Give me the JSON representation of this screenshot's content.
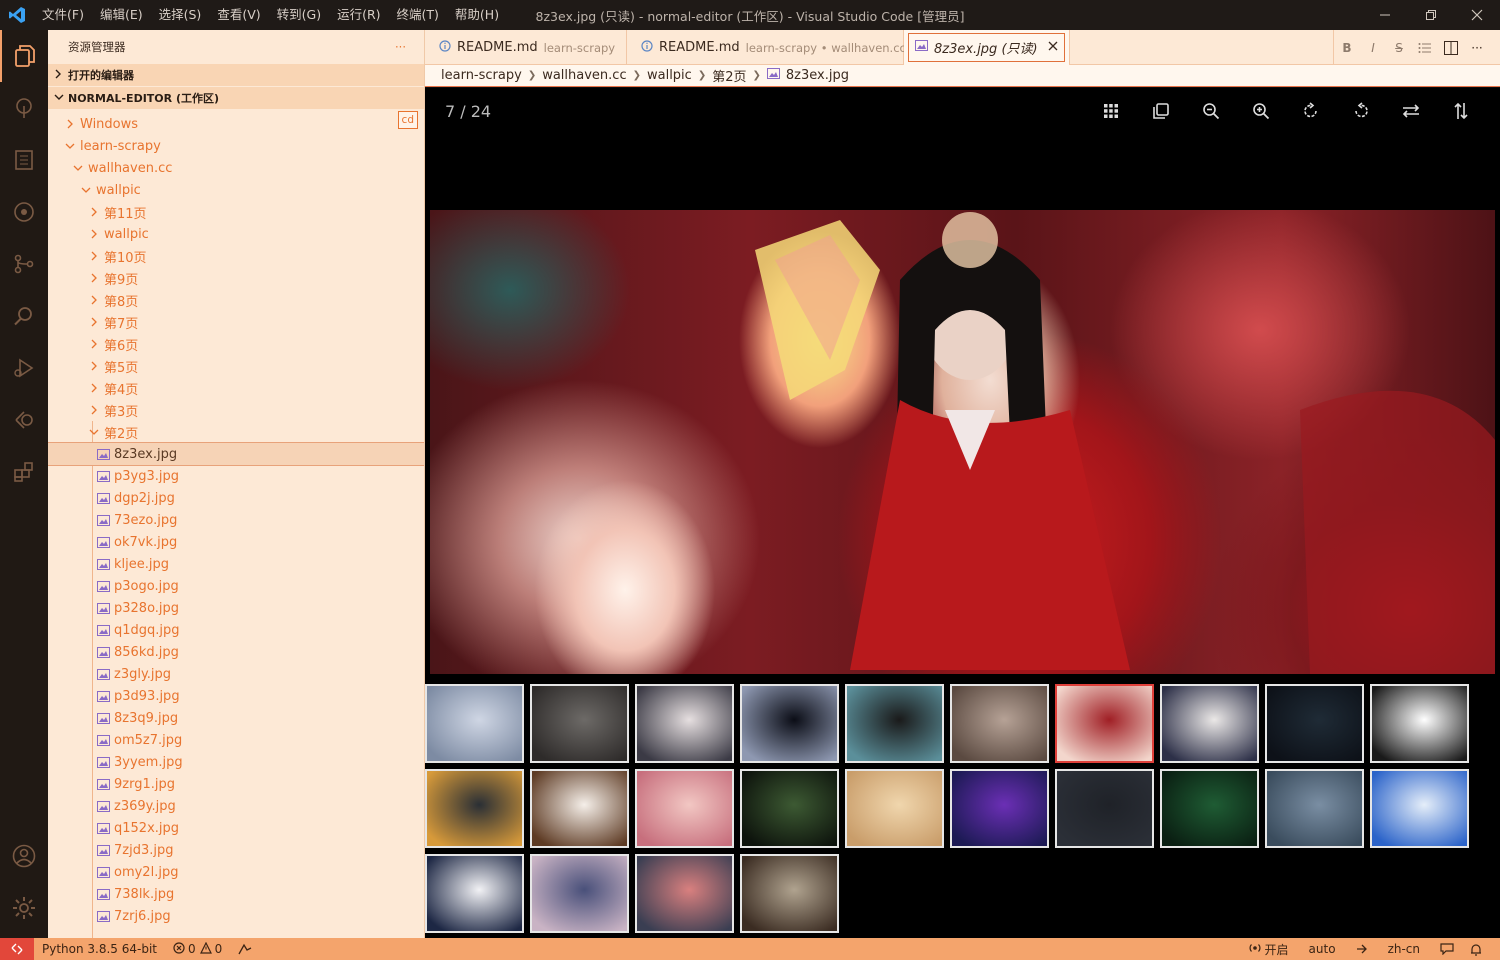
{
  "titlebar": {
    "menu": [
      "文件(F)",
      "编辑(E)",
      "选择(S)",
      "查看(V)",
      "转到(G)",
      "运行(R)",
      "终端(T)",
      "帮助(H)"
    ],
    "title": "8z3ex.jpg (只读) - normal-editor (工作区) - Visual Studio Code [管理员]"
  },
  "sidebar": {
    "header": "资源管理器",
    "more": "···",
    "open_editors": "打开的编辑器",
    "workspace": "NORMAL-EDITOR (工作区)",
    "cd_badge": "cd",
    "tree": [
      {
        "label": "Windows",
        "indent": 0,
        "type": "folder",
        "open": false
      },
      {
        "label": "learn-scrapy",
        "indent": 0,
        "type": "folder",
        "open": true
      },
      {
        "label": "wallhaven.cc",
        "indent": 1,
        "type": "folder",
        "open": true
      },
      {
        "label": "wallpic",
        "indent": 2,
        "type": "folder",
        "open": true
      },
      {
        "label": "第11页",
        "indent": 3,
        "type": "folder",
        "open": false
      },
      {
        "label": "wallpic",
        "indent": 3,
        "type": "folder",
        "open": false
      },
      {
        "label": "第10页",
        "indent": 3,
        "type": "folder",
        "open": false
      },
      {
        "label": "第9页",
        "indent": 3,
        "type": "folder",
        "open": false
      },
      {
        "label": "第8页",
        "indent": 3,
        "type": "folder",
        "open": false
      },
      {
        "label": "第7页",
        "indent": 3,
        "type": "folder",
        "open": false
      },
      {
        "label": "第6页",
        "indent": 3,
        "type": "folder",
        "open": false
      },
      {
        "label": "第5页",
        "indent": 3,
        "type": "folder",
        "open": false
      },
      {
        "label": "第4页",
        "indent": 3,
        "type": "folder",
        "open": false
      },
      {
        "label": "第3页",
        "indent": 3,
        "type": "folder",
        "open": false
      },
      {
        "label": "第2页",
        "indent": 3,
        "type": "folder",
        "open": true
      },
      {
        "label": "8z3ex.jpg",
        "indent": 4,
        "type": "file",
        "selected": true
      },
      {
        "label": "p3yg3.jpg",
        "indent": 4,
        "type": "file"
      },
      {
        "label": "dgp2j.jpg",
        "indent": 4,
        "type": "file"
      },
      {
        "label": "73ezo.jpg",
        "indent": 4,
        "type": "file"
      },
      {
        "label": "ok7vk.jpg",
        "indent": 4,
        "type": "file"
      },
      {
        "label": "kljee.jpg",
        "indent": 4,
        "type": "file"
      },
      {
        "label": "p3ogo.jpg",
        "indent": 4,
        "type": "file"
      },
      {
        "label": "p328o.jpg",
        "indent": 4,
        "type": "file"
      },
      {
        "label": "q1dgq.jpg",
        "indent": 4,
        "type": "file"
      },
      {
        "label": "856kd.jpg",
        "indent": 4,
        "type": "file"
      },
      {
        "label": "z3gly.jpg",
        "indent": 4,
        "type": "file"
      },
      {
        "label": "p3d93.jpg",
        "indent": 4,
        "type": "file"
      },
      {
        "label": "8z3q9.jpg",
        "indent": 4,
        "type": "file"
      },
      {
        "label": "om5z7.jpg",
        "indent": 4,
        "type": "file"
      },
      {
        "label": "3yyem.jpg",
        "indent": 4,
        "type": "file"
      },
      {
        "label": "9zrg1.jpg",
        "indent": 4,
        "type": "file"
      },
      {
        "label": "z369y.jpg",
        "indent": 4,
        "type": "file"
      },
      {
        "label": "q152x.jpg",
        "indent": 4,
        "type": "file"
      },
      {
        "label": "7zjd3.jpg",
        "indent": 4,
        "type": "file"
      },
      {
        "label": "omy2l.jpg",
        "indent": 4,
        "type": "file"
      },
      {
        "label": "738lk.jpg",
        "indent": 4,
        "type": "file"
      },
      {
        "label": "7zrj6.jpg",
        "indent": 4,
        "type": "file"
      }
    ]
  },
  "tabs": [
    {
      "label": "README.md",
      "desc": "learn-scrapy",
      "icon": "info-icon"
    },
    {
      "label": "README.md",
      "desc": "learn-scrapy • wallhaven.cc",
      "icon": "info-icon"
    },
    {
      "label": "8z3ex.jpg (只读)",
      "desc": "",
      "icon": "image-file-icon",
      "active": true
    }
  ],
  "tab_actions": [
    "B",
    "I",
    "S",
    "list",
    "split",
    "···"
  ],
  "breadcrumb": [
    "learn-scrapy",
    "wallhaven.cc",
    "wallpic",
    "第2页",
    "8z3ex.jpg"
  ],
  "viewer": {
    "counter": "7 / 24",
    "tools": [
      "grid-icon",
      "copy-icon",
      "zoom-out-icon",
      "zoom-in-icon",
      "rotate-right-icon",
      "rotate-left-icon",
      "flip-horizontal-icon",
      "flip-vertical-icon"
    ],
    "thumbnails": [
      {
        "colors": [
          "#cfd6e4",
          "#7d8ba3"
        ]
      },
      {
        "colors": [
          "#6d6a67",
          "#2e2b2a"
        ]
      },
      {
        "colors": [
          "#e6dfe0",
          "#3b3a45"
        ]
      },
      {
        "colors": [
          "#0b0d16",
          "#8e98b1"
        ]
      },
      {
        "colors": [
          "#1a1a1a",
          "#5b8f9a"
        ]
      },
      {
        "colors": [
          "#b6a296",
          "#5b4a41"
        ]
      },
      {
        "colors": [
          "#a01f25",
          "#f3d6cc"
        ],
        "active": true
      },
      {
        "colors": [
          "#ebe8e7",
          "#2d3048"
        ]
      },
      {
        "colors": [
          "#1f2b36",
          "#0d1118"
        ]
      },
      {
        "colors": [
          "#ffffff",
          "#1a1a1a"
        ]
      },
      {
        "colors": [
          "#2a2f35",
          "#d79a3a"
        ]
      },
      {
        "colors": [
          "#f5efe9",
          "#5e3b24"
        ]
      },
      {
        "colors": [
          "#f2c7c3",
          "#c76f7d"
        ]
      },
      {
        "colors": [
          "#3d5a33",
          "#0d130c"
        ]
      },
      {
        "colors": [
          "#f0d6ad",
          "#c99d6a"
        ]
      },
      {
        "colors": [
          "#6b2fb5",
          "#1c1a54"
        ]
      },
      {
        "colors": [
          "#1f2228",
          "#2b2f37"
        ]
      },
      {
        "colors": [
          "#1f5c34",
          "#0a1f12"
        ]
      },
      {
        "colors": [
          "#7a8ea3",
          "#3a4c5d"
        ]
      },
      {
        "colors": [
          "#e5eef9",
          "#2b63c9"
        ]
      },
      {
        "colors": [
          "#f2f2f5",
          "#1d2744"
        ]
      },
      {
        "colors": [
          "#49507a",
          "#c9b3c4"
        ]
      },
      {
        "colors": [
          "#d9807f",
          "#3a3e52"
        ]
      },
      {
        "colors": [
          "#b0a38f",
          "#3b2c22"
        ]
      }
    ]
  },
  "statusbar": {
    "python": "Python 3.8.5 64-bit",
    "errors": "0",
    "warnings": "0",
    "open_label": "开启",
    "auto": "auto",
    "lang": "zh-cn"
  },
  "colors": {
    "accent": "#e8742f",
    "statusbar": "#f4a46c",
    "sidebar_bg": "#fde9d6",
    "activitybar_bg": "#201914"
  }
}
